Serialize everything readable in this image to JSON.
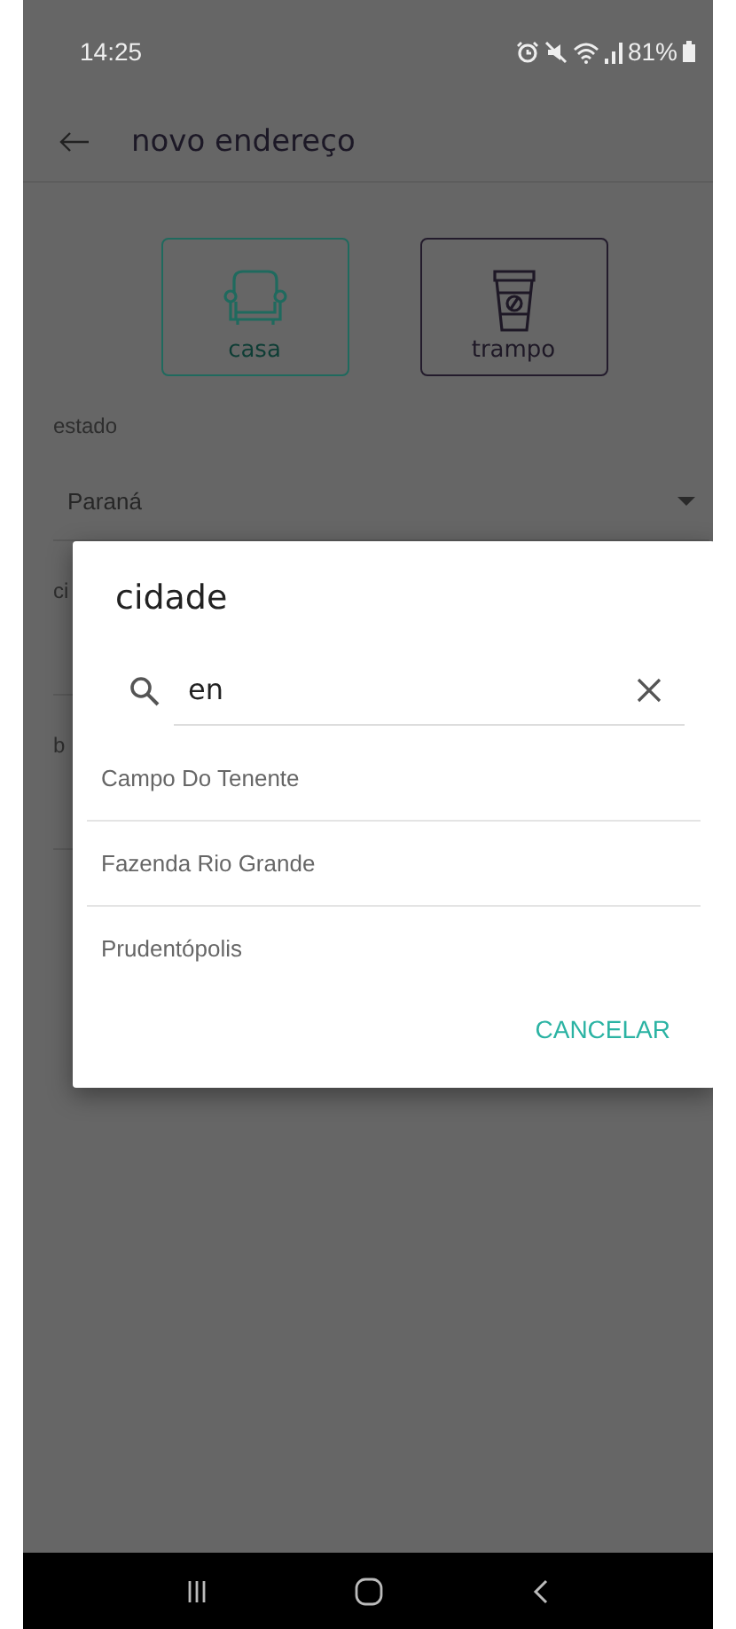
{
  "status_bar": {
    "time": "14:25",
    "battery": "81%"
  },
  "app_bar": {
    "title": "novo endereço"
  },
  "address_types": [
    {
      "label": "casa",
      "kind": "armchair",
      "selected": true
    },
    {
      "label": "trampo",
      "kind": "coffee-cup",
      "selected": false
    }
  ],
  "fields": [
    {
      "label": "estado",
      "value": "Paraná",
      "kind": "dropdown"
    },
    {
      "label": "ci",
      "kind": "text"
    },
    {
      "label": "b",
      "kind": "text"
    }
  ],
  "dialog": {
    "title": "cidade",
    "search": {
      "value": "en"
    },
    "results": [
      "Campo Do Tenente",
      "Fazenda Rio Grande",
      "Prudentópolis"
    ],
    "action": "CANCELAR"
  }
}
